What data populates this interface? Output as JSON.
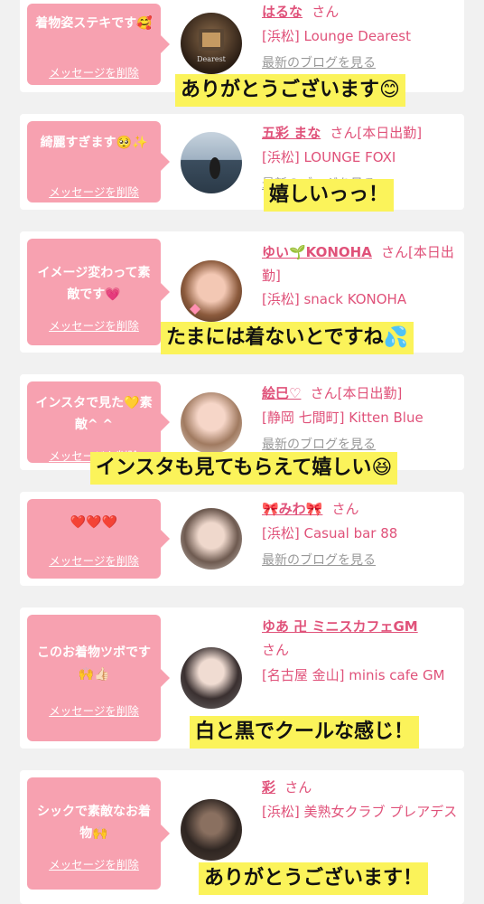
{
  "delete_label": "メッセージを削除",
  "blog_label": "最新のブログを見る",
  "san": "さん",
  "cards": [
    {
      "message": "着物姿ステキです🥰",
      "name": "はるな",
      "suffix": "",
      "shop": "[浜松] Lounge Dearest",
      "avatar": "photo-dark-logo",
      "caption": "ありがとうございます😊"
    },
    {
      "message": "綺麗すぎます🥺✨",
      "name": "五彩 まな",
      "suffix": "[本日出勤]",
      "shop": "[浜松] LOUNGE FOXI",
      "avatar": "photo-beach",
      "caption": "嬉しいっっ！"
    },
    {
      "message": "イメージ変わって素敵です💗",
      "name": "ゆい🌱KONOHA",
      "suffix": "[本日出勤]",
      "shop": "[浜松] snack KONOHA",
      "avatar": "photo-portrait",
      "caption": "たまには着ないとですね💦"
    },
    {
      "message": "インスタで見た💛素敵^ ^",
      "name": "絵巳♡",
      "suffix": "[本日出勤]",
      "shop": "[静岡 七間町] Kitten Blue",
      "avatar": "photo-portrait",
      "caption": "インスタも見てもらえて嬉しい😆"
    },
    {
      "message": "❤️❤️❤️",
      "name": "🎀みわ🎀",
      "suffix": "",
      "shop": "[浜松] Casual bar 88",
      "avatar": "photo-portrait",
      "caption": ""
    },
    {
      "message": "このお着物ツボです🙌👍🏻",
      "name": "ゆあ 卍 ミニスカフェGM",
      "suffix": "",
      "shop": "[名古屋 金山] minis cafe GM",
      "avatar": "photo-portrait",
      "caption": "白と黒でクールな感じ！"
    },
    {
      "message": "シックで素敵なお着物🙌",
      "name": "彩",
      "suffix": "",
      "shop": "[浜松] 美熟女クラブ プレアデス",
      "avatar": "photo-interior",
      "caption": "ありがとうございます！"
    }
  ]
}
